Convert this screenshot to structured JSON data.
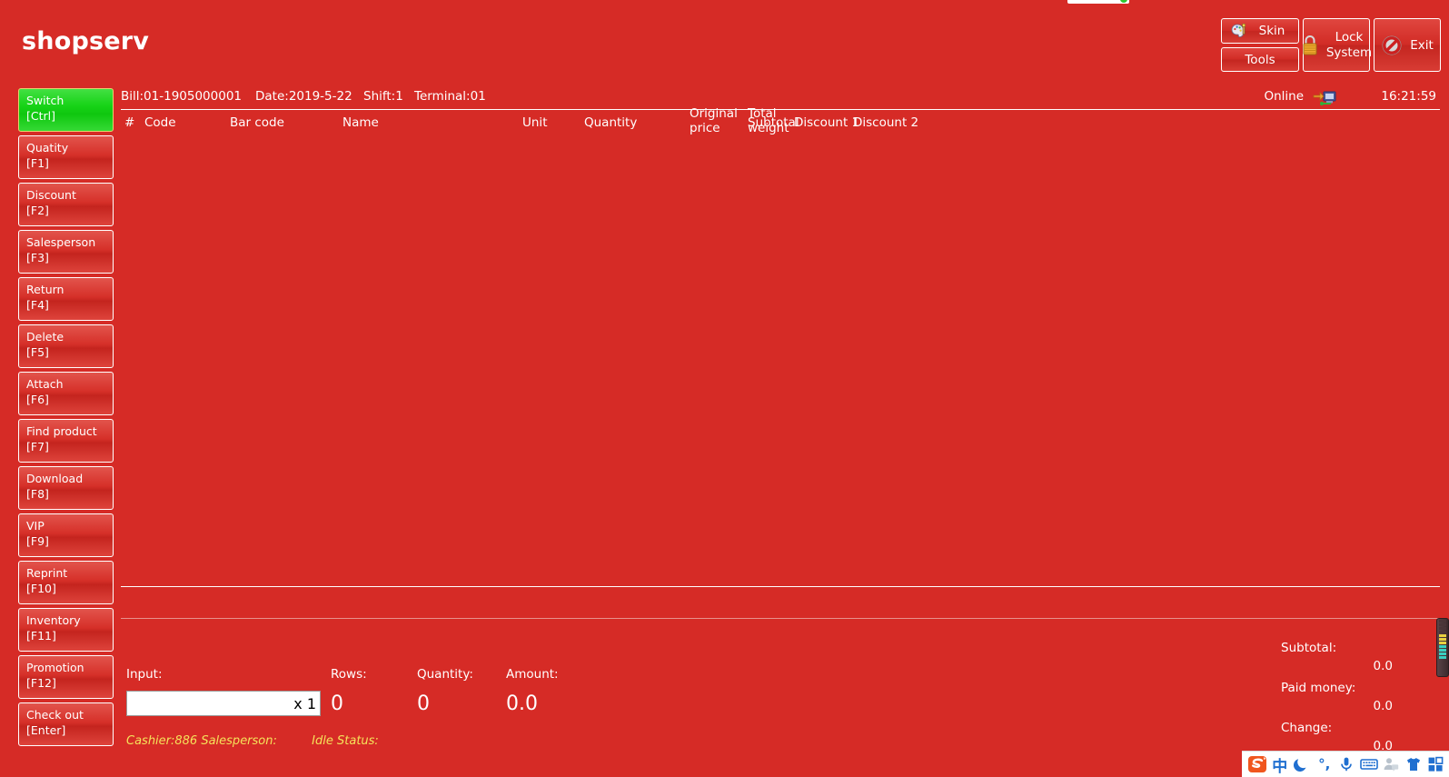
{
  "app": {
    "title": "shopserv",
    "accent_red": "#d62b26",
    "active_green": "#17d317",
    "status_yellow": "#f5e25a"
  },
  "toolbar": {
    "skin_label": "Skin",
    "tools_label": "Tools",
    "lock_line1": "Lock",
    "lock_line2": "System",
    "exit_label": "Exit"
  },
  "sidebar": {
    "items": [
      {
        "label": "Switch",
        "key": "[Ctrl]",
        "active": true
      },
      {
        "label": "Quatity",
        "key": "[F1]",
        "active": false
      },
      {
        "label": "Discount",
        "key": "[F2]",
        "active": false
      },
      {
        "label": "Salesperson",
        "key": "[F3]",
        "active": false
      },
      {
        "label": "Return",
        "key": "[F4]",
        "active": false
      },
      {
        "label": "Delete",
        "key": "[F5]",
        "active": false
      },
      {
        "label": "Attach",
        "key": "[F6]",
        "active": false
      },
      {
        "label": "Find product",
        "key": "[F7]",
        "active": false
      },
      {
        "label": "Download",
        "key": "[F8]",
        "active": false
      },
      {
        "label": "VIP",
        "key": "[F9]",
        "active": false
      },
      {
        "label": "Reprint",
        "key": "[F10]",
        "active": false
      },
      {
        "label": "Inventory",
        "key": "[F11]",
        "active": false
      },
      {
        "label": "Promotion",
        "key": "[F12]",
        "active": false
      },
      {
        "label": "Check out",
        "key": "[Enter]",
        "active": false
      }
    ]
  },
  "billbar": {
    "bill": "Bill:01-1905000001",
    "date": "Date:2019-5-22",
    "shift": "Shift:1",
    "terminal": "Terminal:01",
    "online": "Online",
    "time": "16:21:59"
  },
  "table": {
    "headers": {
      "num": "#",
      "code": "Code",
      "barcode": "Bar code",
      "name": "Name",
      "unit": "Unit",
      "quantity": "Quantity",
      "original_price_l1": "Original",
      "original_price_l2": "price",
      "total_weight_l1": "Total",
      "total_weight_l2": "weight",
      "subtotal": "Subtotal",
      "discount1": "Discount 1",
      "discount2": "Discount 2"
    },
    "rows": []
  },
  "input_panel": {
    "input_label": "Input:",
    "input_value": "",
    "input_placeholder": "",
    "multiplier": "x 1",
    "rows_label": "Rows:",
    "rows_value": "0",
    "quantity_label": "Quantity:",
    "quantity_value": "0",
    "amount_label": "Amount:",
    "amount_value": "0.0"
  },
  "status": {
    "cashier": "Cashier:886 Salesperson:",
    "idle": "Idle Status:"
  },
  "totals": {
    "subtotal_label": "Subtotal:",
    "subtotal_value": "0.0",
    "paid_label": "Paid money:",
    "paid_value": "0.0",
    "change_label": "Change:",
    "change_value": "0.0"
  },
  "ime": {
    "logo": "sogou-logo-icon",
    "mode": "中",
    "shape": "moon-icon",
    "punctuation": "°,",
    "mic": "microphone-icon",
    "keyboard": "soft-keyboard-icon",
    "user": "user-speech-icon",
    "skin": "tshirt-skin-icon",
    "toolbox": "toolbox-grid-icon"
  }
}
